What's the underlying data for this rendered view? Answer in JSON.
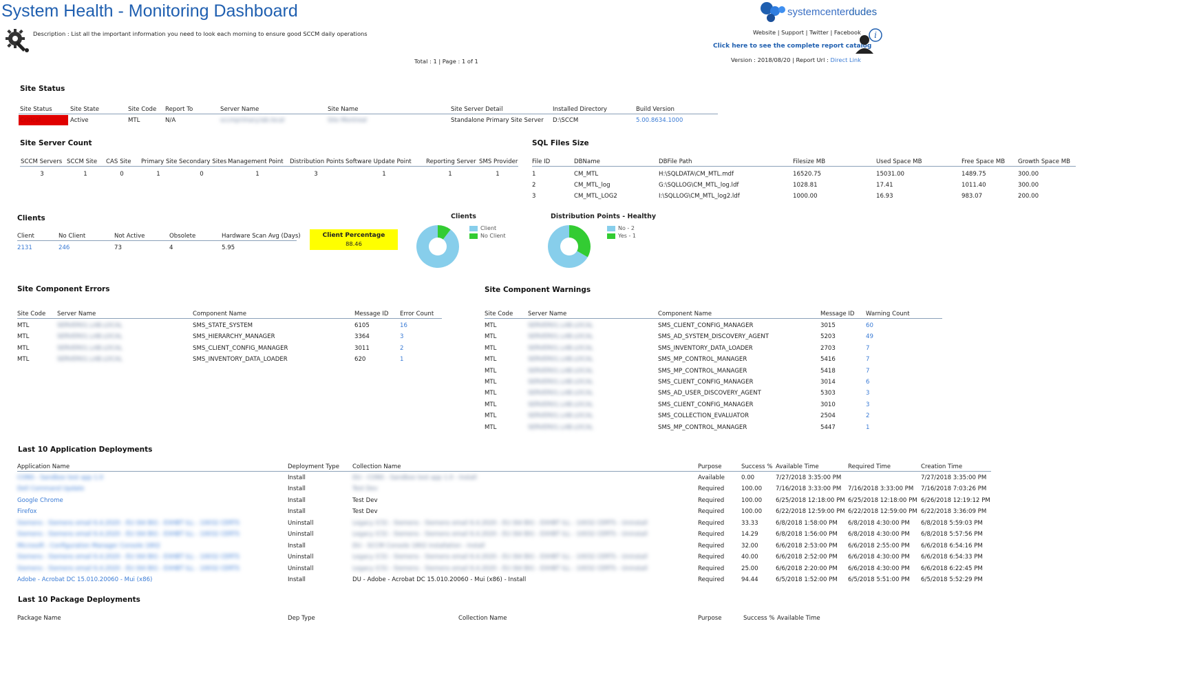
{
  "header": {
    "title": "System Health - Monitoring Dashboard",
    "description": "Description : List all the important information you need to look each morning to ensure good SCCM daily operations",
    "pager": "Total : 1 | Page : 1 of 1",
    "brand": "systemcenterdudes",
    "brand_bold": "dudes",
    "brand_light": "systemcenter",
    "links": "Website | Support | Twitter | Facebook",
    "catalog": "Click here to see the complete report catalog",
    "version_prefix": "Version : 2018/08/20 | Report Url : ",
    "version_link": "Direct Link"
  },
  "site_status": {
    "title": "Site Status",
    "headers": [
      "Site Status",
      "Site State",
      "Site Code",
      "Report To",
      "Server Name",
      "Site Name",
      "Site Server Detail",
      "Installed Directory",
      "Build Version"
    ],
    "row": {
      "status": "Critical",
      "state": "Active",
      "code": "MTL",
      "report_to": "N/A",
      "server": "sccmprimary.lab.local",
      "site_name": "Site Montreal",
      "detail": "Standalone Primary Site Server",
      "dir": "D:\\SCCM",
      "build": "5.00.8634.1000"
    },
    "status_color": "#e00000"
  },
  "server_count": {
    "title": "Site Server Count",
    "headers": [
      "SCCM Servers",
      "SCCM Site",
      "CAS Site",
      "Primary Site",
      "Secondary Sites",
      "Management Point",
      "Distribution Points",
      "Software Update Point",
      "Reporting Server",
      "SMS Provider"
    ],
    "values": [
      "3",
      "1",
      "0",
      "1",
      "0",
      "1",
      "3",
      "1",
      "1",
      "1"
    ]
  },
  "sql_files": {
    "title": "SQL Files Size",
    "headers": [
      "File ID",
      "DBName",
      "DBFile Path",
      "Filesize MB",
      "Used Space MB",
      "Free Space MB",
      "Growth Space MB"
    ],
    "rows": [
      [
        "1",
        "CM_MTL",
        "H:\\SQLDATA\\CM_MTL.mdf",
        "16520.75",
        "15031.00",
        "1489.75",
        "300.00"
      ],
      [
        "2",
        "CM_MTL_log",
        "G:\\SQLLOG\\CM_MTL_log.ldf",
        "1028.81",
        "17.41",
        "1011.40",
        "300.00"
      ],
      [
        "3",
        "CM_MTL_LOG2",
        "I:\\SQLLOG\\CM_MTL_log2.ldf",
        "1000.00",
        "16.93",
        "983.07",
        "200.00"
      ]
    ]
  },
  "clients": {
    "title": "Clients",
    "headers": [
      "Client",
      "No Client",
      "Not Active",
      "Obsolete",
      "Hardware Scan Avg (Days)"
    ],
    "values": [
      "2131",
      "246",
      "73",
      "4",
      "5.95"
    ],
    "percentage_label": "Client Percentage",
    "percentage_value": "88.46",
    "highlight_color": "#ffff00"
  },
  "charts": {
    "clients": {
      "title": "Clients",
      "legend": [
        "Client",
        "No Client"
      ],
      "colors": [
        "#87ceeb",
        "#33cc33"
      ]
    },
    "dp": {
      "title": "Distribution Points - Healthy",
      "legend": [
        "No - 2",
        "Yes - 1"
      ],
      "colors": [
        "#87ceeb",
        "#33cc33"
      ]
    }
  },
  "chart_data": [
    {
      "type": "pie",
      "title": "Clients",
      "categories": [
        "Client",
        "No Client"
      ],
      "values": [
        2131,
        246
      ],
      "donut": true
    },
    {
      "type": "pie",
      "title": "Distribution Points - Healthy",
      "categories": [
        "No - 2",
        "Yes - 1"
      ],
      "values": [
        2,
        1
      ],
      "donut": true
    }
  ],
  "errors": {
    "title": "Site Component Errors",
    "headers": [
      "Site Code",
      "Server Name",
      "Component Name",
      "Message ID",
      "Error Count"
    ],
    "rows": [
      [
        "MTL",
        "SERVER01.LAB.LOCAL",
        "SMS_STATE_SYSTEM",
        "6105",
        "16"
      ],
      [
        "MTL",
        "SERVER01.LAB.LOCAL",
        "SMS_HIERARCHY_MANAGER",
        "3364",
        "3"
      ],
      [
        "MTL",
        "SERVER01.LAB.LOCAL",
        "SMS_CLIENT_CONFIG_MANAGER",
        "3011",
        "2"
      ],
      [
        "MTL",
        "SERVER01.LAB.LOCAL",
        "SMS_INVENTORY_DATA_LOADER",
        "620",
        "1"
      ]
    ]
  },
  "warnings": {
    "title": "Site Component Warnings",
    "headers": [
      "Site Code",
      "Server Name",
      "Component Name",
      "Message ID",
      "Warning Count"
    ],
    "rows": [
      [
        "MTL",
        "SERVER01.LAB.LOCAL",
        "SMS_CLIENT_CONFIG_MANAGER",
        "3015",
        "60"
      ],
      [
        "MTL",
        "SERVER01.LAB.LOCAL",
        "SMS_AD_SYSTEM_DISCOVERY_AGENT",
        "5203",
        "49"
      ],
      [
        "MTL",
        "SERVER01.LAB.LOCAL",
        "SMS_INVENTORY_DATA_LOADER",
        "2703",
        "7"
      ],
      [
        "MTL",
        "SERVER01.LAB.LOCAL",
        "SMS_MP_CONTROL_MANAGER",
        "5416",
        "7"
      ],
      [
        "MTL",
        "SERVER01.LAB.LOCAL",
        "SMS_MP_CONTROL_MANAGER",
        "5418",
        "7"
      ],
      [
        "MTL",
        "SERVER01.LAB.LOCAL",
        "SMS_CLIENT_CONFIG_MANAGER",
        "3014",
        "6"
      ],
      [
        "MTL",
        "SERVER01.LAB.LOCAL",
        "SMS_AD_USER_DISCOVERY_AGENT",
        "5303",
        "3"
      ],
      [
        "MTL",
        "SERVER01.LAB.LOCAL",
        "SMS_CLIENT_CONFIG_MANAGER",
        "3010",
        "3"
      ],
      [
        "MTL",
        "SERVER01.LAB.LOCAL",
        "SMS_COLLECTION_EVALUATOR",
        "2504",
        "2"
      ],
      [
        "MTL",
        "SERVER01.LAB.LOCAL",
        "SMS_MP_CONTROL_MANAGER",
        "5447",
        "1"
      ]
    ]
  },
  "app_deployments": {
    "title": "Last 10 Application Deployments",
    "headers": [
      "Application Name",
      "Deployment Type",
      "Collection Name",
      "Purpose",
      "Success %",
      "Available Time",
      "Required Time",
      "Creation Time"
    ],
    "rows": [
      [
        "CONS - Sandbox test app 1.0",
        "Install",
        "DU - CONS - Sandbox test app 1.0 - Install",
        "Available",
        "0.00",
        "7/27/2018 3:35:00 PM",
        "",
        "7/27/2018 3:35:00 PM",
        true
      ],
      [
        "Dell Command Update",
        "Install",
        "Test Dev",
        "Required",
        "100.00",
        "7/16/2018 3:33:00 PM",
        "7/16/2018 3:33:00 PM",
        "7/16/2018 7:03:26 PM",
        true
      ],
      [
        "Google Chrome",
        "Install",
        "Test Dev",
        "Required",
        "100.00",
        "6/25/2018 12:18:00 PM",
        "6/25/2018 12:18:00 PM",
        "6/26/2018 12:19:12 PM",
        false
      ],
      [
        "Firefox",
        "Install",
        "Test Dev",
        "Required",
        "100.00",
        "6/22/2018 12:59:00 PM",
        "6/22/2018 12:59:00 PM",
        "6/22/2018 3:36:09 PM",
        false
      ],
      [
        "Siemens - Siemens email 6.4.2020 - EU (64 Bit) - EXHBT ILL - 10032 CERTS",
        "Uninstall",
        "Legacy (CS) - Siemens - Siemens email 6.4.2020 - EU (64 Bit) - EXHBT ILL - 10032 CERTS - Uninstall",
        "Required",
        "33.33",
        "6/8/2018 1:58:00 PM",
        "6/8/2018 4:30:00 PM",
        "6/8/2018 5:59:03 PM",
        true
      ],
      [
        "Siemens - Siemens email 6.4.2020 - EU (64 Bit) - EXHBT ILL - 10032 CERTS",
        "Uninstall",
        "Legacy (CS) - Siemens - Siemens email 6.4.2020 - EU (64 Bit) - EXHBT ILL - 10032 CERTS - Uninstall",
        "Required",
        "14.29",
        "6/8/2018 1:56:00 PM",
        "6/8/2018 4:30:00 PM",
        "6/8/2018 5:57:56 PM",
        true
      ],
      [
        "Microsoft - Configuration Manager Console 1802",
        "Install",
        "DU - SCCM Console 1802 installation - Install",
        "Required",
        "32.00",
        "6/6/2018 2:53:00 PM",
        "6/6/2018 2:55:00 PM",
        "6/6/2018 6:54:16 PM",
        true
      ],
      [
        "Siemens - Siemens email 6.4.2020 - EU (64 Bit) - EXHBT ILL - 10032 CERTS",
        "Uninstall",
        "Legacy (CS) - Siemens - Siemens email 6.4.2020 - EU (64 Bit) - EXHBT ILL - 10032 CERTS - Uninstall",
        "Required",
        "40.00",
        "6/6/2018 2:52:00 PM",
        "6/6/2018 4:30:00 PM",
        "6/6/2018 6:54:33 PM",
        true
      ],
      [
        "Siemens - Siemens email 6.4.2020 - EU (64 Bit) - EXHBT ILL - 10032 CERTS",
        "Uninstall",
        "Legacy (CS) - Siemens - Siemens email 6.4.2020 - EU (64 Bit) - EXHBT ILL - 10032 CERTS - Uninstall",
        "Required",
        "25.00",
        "6/6/2018 2:20:00 PM",
        "6/6/2018 4:30:00 PM",
        "6/6/2018 6:22:45 PM",
        true
      ],
      [
        "Adobe - Acrobat DC 15.010.20060 - Mui (x86)",
        "Install",
        "DU - Adobe - Acrobat DC 15.010.20060 - Mui (x86) - Install",
        "Required",
        "94.44",
        "6/5/2018 1:52:00 PM",
        "6/5/2018 5:51:00 PM",
        "6/5/2018 5:52:29 PM",
        false
      ]
    ]
  },
  "pkg_deployments": {
    "title": "Last 10 Package Deployments",
    "headers": [
      "Package Name",
      "Dep Type",
      "Collection Name",
      "Purpose",
      "Success %",
      "Available Time"
    ]
  }
}
